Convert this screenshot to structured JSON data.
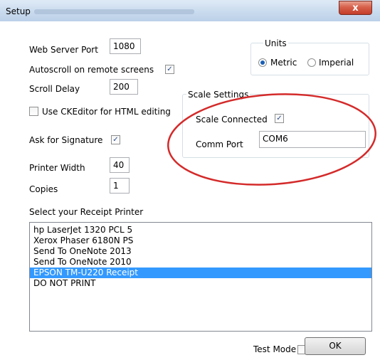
{
  "window": {
    "title": "Setup",
    "close_glyph": "x"
  },
  "fields": {
    "web_server_port": {
      "label": "Web Server Port",
      "value": "1080"
    },
    "autoscroll": {
      "label": "Autoscroll on remote screens",
      "checked": true
    },
    "scroll_delay": {
      "label": "Scroll Delay",
      "value": "200"
    },
    "ckeditor": {
      "label": "Use CKEditor for HTML editing",
      "checked": false
    },
    "ask_signature": {
      "label": "Ask for Signature",
      "checked": true
    },
    "printer_width": {
      "label": "Printer Width",
      "value": "40"
    },
    "copies": {
      "label": "Copies",
      "value": "1"
    },
    "receipt_printer_label": "Select your Receipt Printer"
  },
  "units": {
    "label": "Units",
    "options": [
      {
        "label": "Metric",
        "selected": true
      },
      {
        "label": "Imperial",
        "selected": false
      }
    ]
  },
  "scale_settings": {
    "label": "Scale Settings",
    "scale_connected": {
      "label": "Scale Connected",
      "checked": true
    },
    "comm_port": {
      "label": "Comm Port",
      "value": "COM6"
    }
  },
  "printers": [
    {
      "name": "hp LaserJet 1320 PCL 5",
      "selected": false
    },
    {
      "name": "Xerox Phaser 6180N PS",
      "selected": false
    },
    {
      "name": "Send To OneNote 2013",
      "selected": false
    },
    {
      "name": "Send To OneNote 2010",
      "selected": false
    },
    {
      "name": "EPSON TM-U220 Receipt",
      "selected": true
    },
    {
      "name": "DO NOT PRINT",
      "selected": false
    }
  ],
  "footer": {
    "test_mode_label": "Test Mode",
    "test_mode_checked": false,
    "ok_label": "OK"
  },
  "colors": {
    "selection": "#3399ff",
    "annotation": "#d42a2a"
  }
}
